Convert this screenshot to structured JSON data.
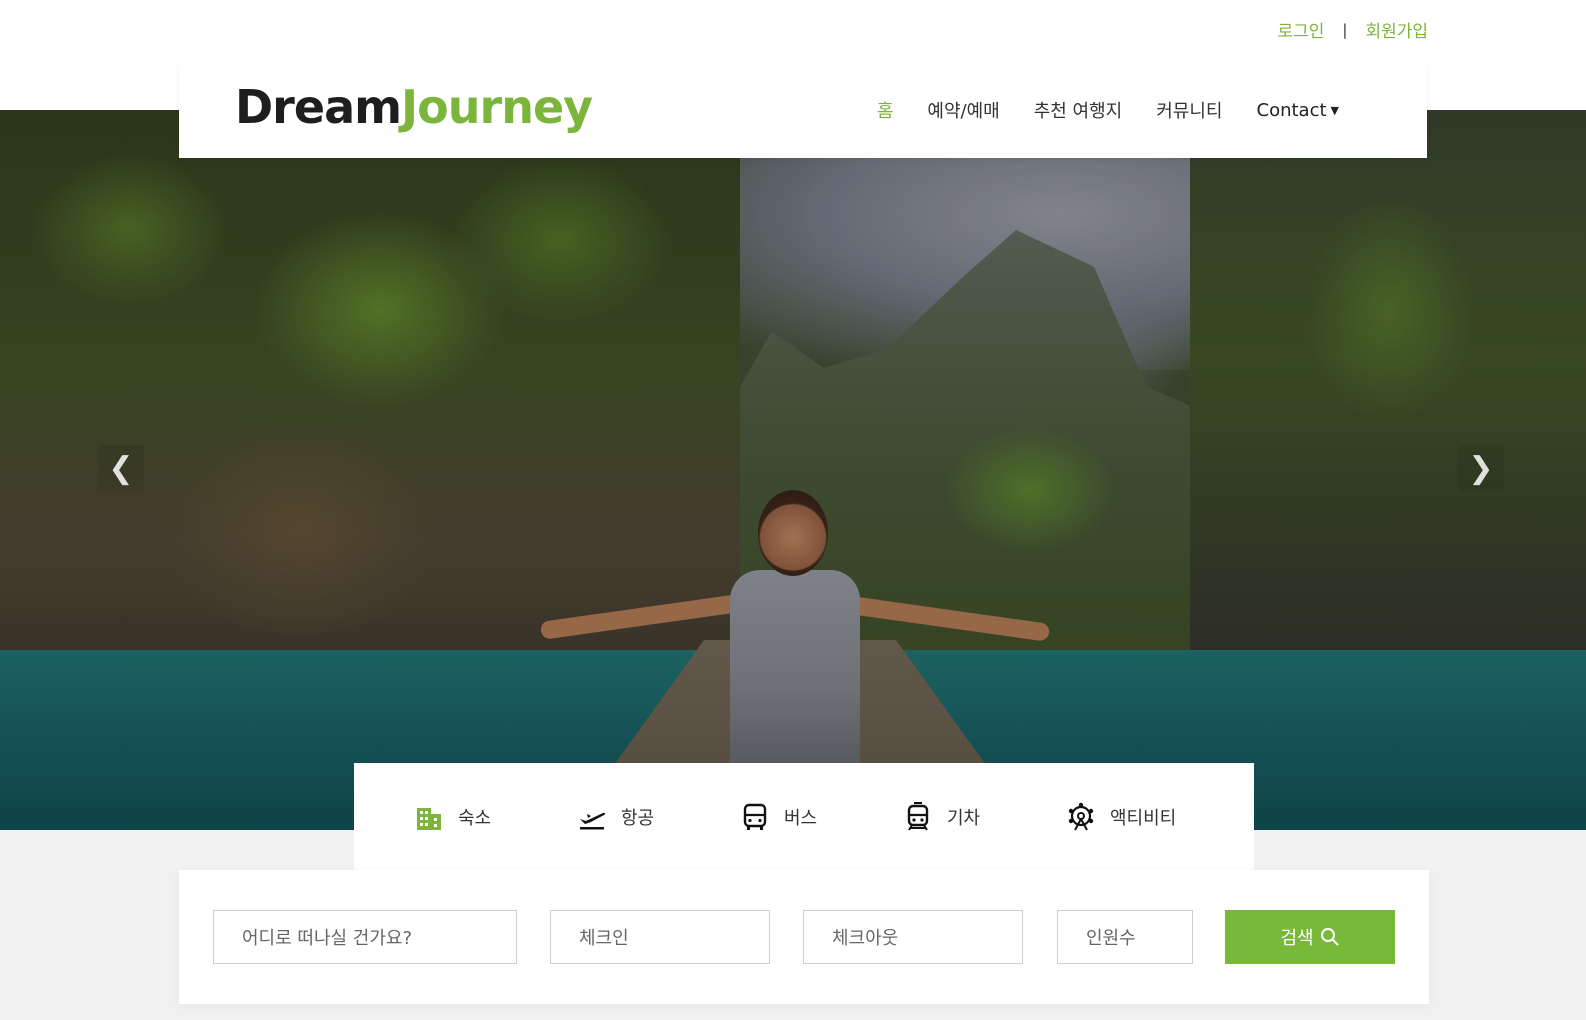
{
  "top_links": {
    "login": "로그인",
    "separator": "|",
    "signup": "회원가입"
  },
  "header": {
    "logo_part1": "Dream",
    "logo_part2": "Journey",
    "nav": [
      {
        "label": "홈",
        "active": true
      },
      {
        "label": "예약/예매"
      },
      {
        "label": "추천 여행지"
      },
      {
        "label": "커뮤니티"
      },
      {
        "label": "Contact"
      }
    ]
  },
  "categories": [
    {
      "label": "숙소",
      "icon": "building-icon"
    },
    {
      "label": "항공",
      "icon": "plane-departure-icon"
    },
    {
      "label": "버스",
      "icon": "bus-icon"
    },
    {
      "label": "기차",
      "icon": "train-icon"
    },
    {
      "label": "액티비티",
      "icon": "ferris-wheel-icon"
    }
  ],
  "search": {
    "destination_placeholder": "어디로 떠나실 건가요?",
    "checkin_placeholder": "체크인",
    "checkout_placeholder": "체크아웃",
    "guests_placeholder": "인원수",
    "button_label": "검색"
  },
  "colors": {
    "accent": "#7cb53b",
    "button": "#78b93a",
    "text_dark": "#1e1e1e"
  }
}
